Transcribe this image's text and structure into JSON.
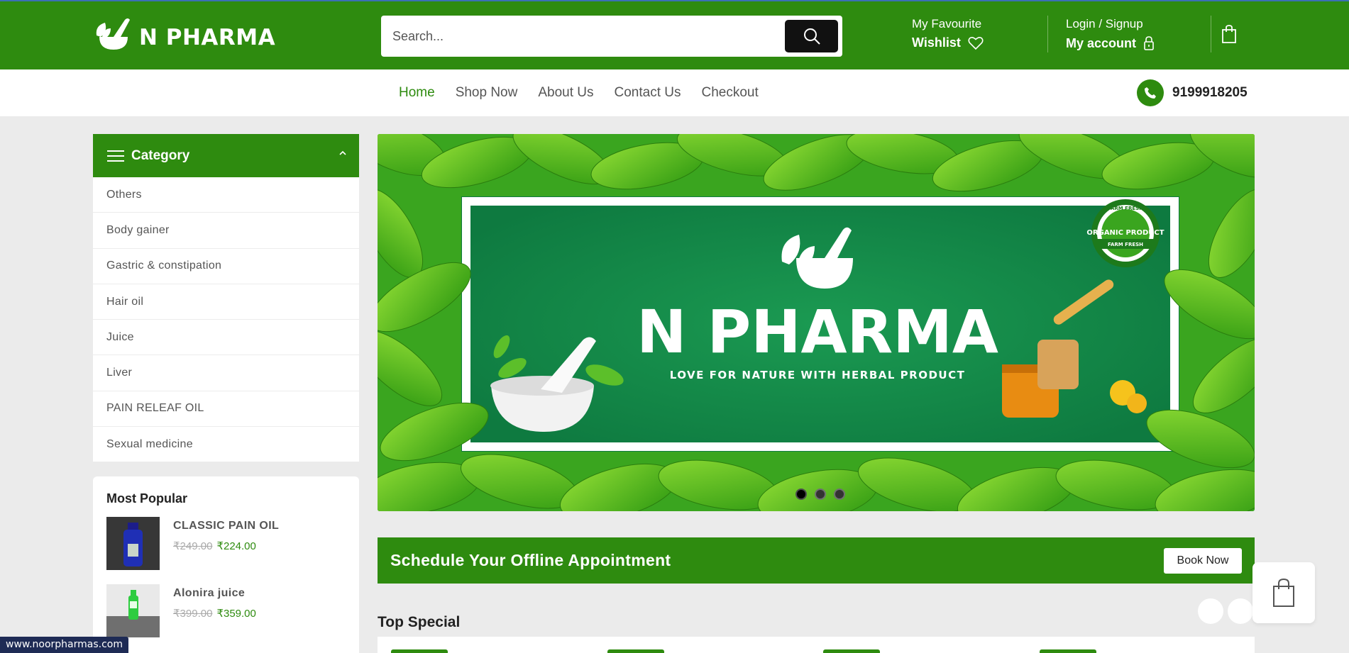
{
  "brand": {
    "name": "N PHARMA"
  },
  "search": {
    "placeholder": "Search..."
  },
  "header": {
    "favourite_label": "My Favourite",
    "wishlist_label": "Wishlist",
    "login_label": "Login / Signup",
    "account_label": "My account"
  },
  "nav": {
    "items": [
      {
        "label": "Home",
        "active": true
      },
      {
        "label": "Shop Now"
      },
      {
        "label": "About Us"
      },
      {
        "label": "Contact Us"
      },
      {
        "label": "Checkout"
      }
    ]
  },
  "contact": {
    "phone": "9199918205"
  },
  "sidebar": {
    "category_title": "Category",
    "categories": [
      "Others",
      "Body gainer",
      "Gastric & constipation",
      "Hair oil",
      "Juice",
      "Liver",
      "PAIN RELEAF OIL",
      "Sexual medicine"
    ],
    "popular_title": "Most Popular",
    "popular": [
      {
        "name": "CLASSIC PAIN OIL",
        "old_price": "₹249.00",
        "price": "₹224.00"
      },
      {
        "name": "Alonira juice",
        "old_price": "₹399.00",
        "price": "₹359.00"
      }
    ]
  },
  "banner": {
    "title": "N PHARMA",
    "tagline": "LOVE FOR NATURE WITH HERBAL PRODUCT",
    "badge_top": "FARM FRESH",
    "badge_main": "ORGANIC PRODUCT",
    "badge_bottom": "FARM FRESH",
    "slides": 3,
    "active_slide": 1
  },
  "appointment": {
    "text": "Schedule Your Offline Appointment",
    "button": "Book Now"
  },
  "top_special": {
    "title": "Top Special"
  },
  "status_url": "www.noorpharmas.com",
  "colors": {
    "brand_green": "#2e8b0f",
    "dark": "#111111"
  }
}
